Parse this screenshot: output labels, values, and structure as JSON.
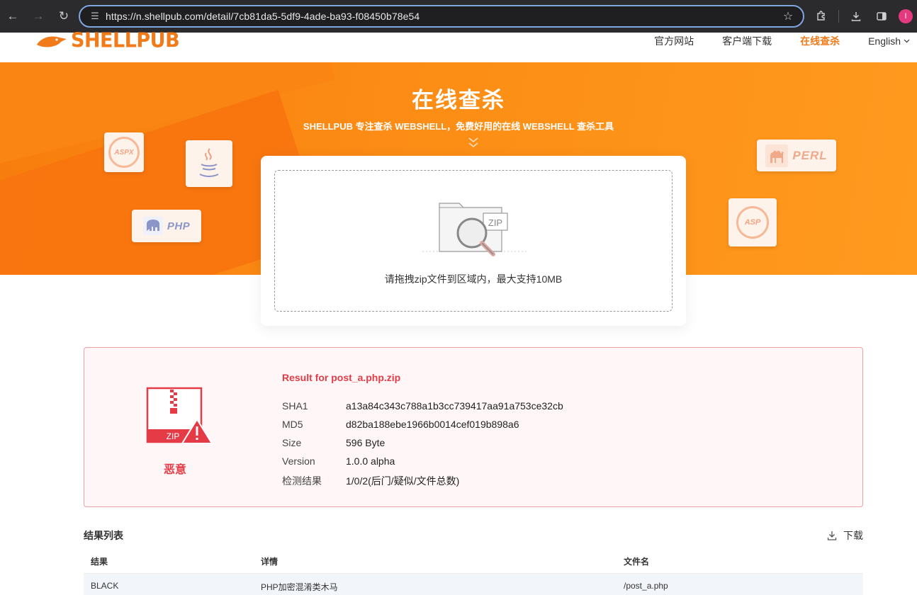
{
  "browser": {
    "url": "https://n.shellpub.com/detail/7cb81da5-5df9-4ade-ba93-f08450b78e54",
    "profile_initial": "I"
  },
  "site": {
    "logo_text": "SHELLPUB",
    "nav": [
      {
        "label": "官方网站"
      },
      {
        "label": "客户端下载"
      },
      {
        "label": "在线查杀"
      },
      {
        "label": "English"
      }
    ]
  },
  "hero": {
    "title": "在线查杀",
    "subtitle": "SHELLPUB 专注查杀 WEBSHELL，免费好用的在线 WEBSHELL 查杀工具",
    "badges": {
      "aspx": "ASPX",
      "php": "PHP",
      "perl": "PERL",
      "asp": "ASP"
    }
  },
  "upload": {
    "zip_label": "ZIP",
    "hint": "请拖拽zip文件到区域内，最大支持10MB"
  },
  "result": {
    "zip_label": "ZIP",
    "verdict": "恶意",
    "title": "Result for post_a.php.zip",
    "fields": [
      {
        "key": "SHA1",
        "value": "a13a84c343c788a1b3cc739417aa91a753ce32cb"
      },
      {
        "key": "MD5",
        "value": "d82ba188ebe1966b0014cef019b898a6"
      },
      {
        "key": "Size",
        "value": "596 Byte"
      },
      {
        "key": "Version",
        "value": "1.0.0 alpha"
      },
      {
        "key": "检测结果",
        "value": "1/0/2(后门/疑似/文件总数)"
      }
    ]
  },
  "list": {
    "title": "结果列表",
    "download_label": "下载",
    "columns": [
      "结果",
      "详情",
      "文件名"
    ],
    "rows": [
      {
        "result": "BLACK",
        "detail": "PHP加密混淆类木马",
        "filename": "/post_a.php"
      }
    ]
  },
  "colors": {
    "brand_orange": "#f17a1a",
    "danger_red": "#e53b47"
  }
}
